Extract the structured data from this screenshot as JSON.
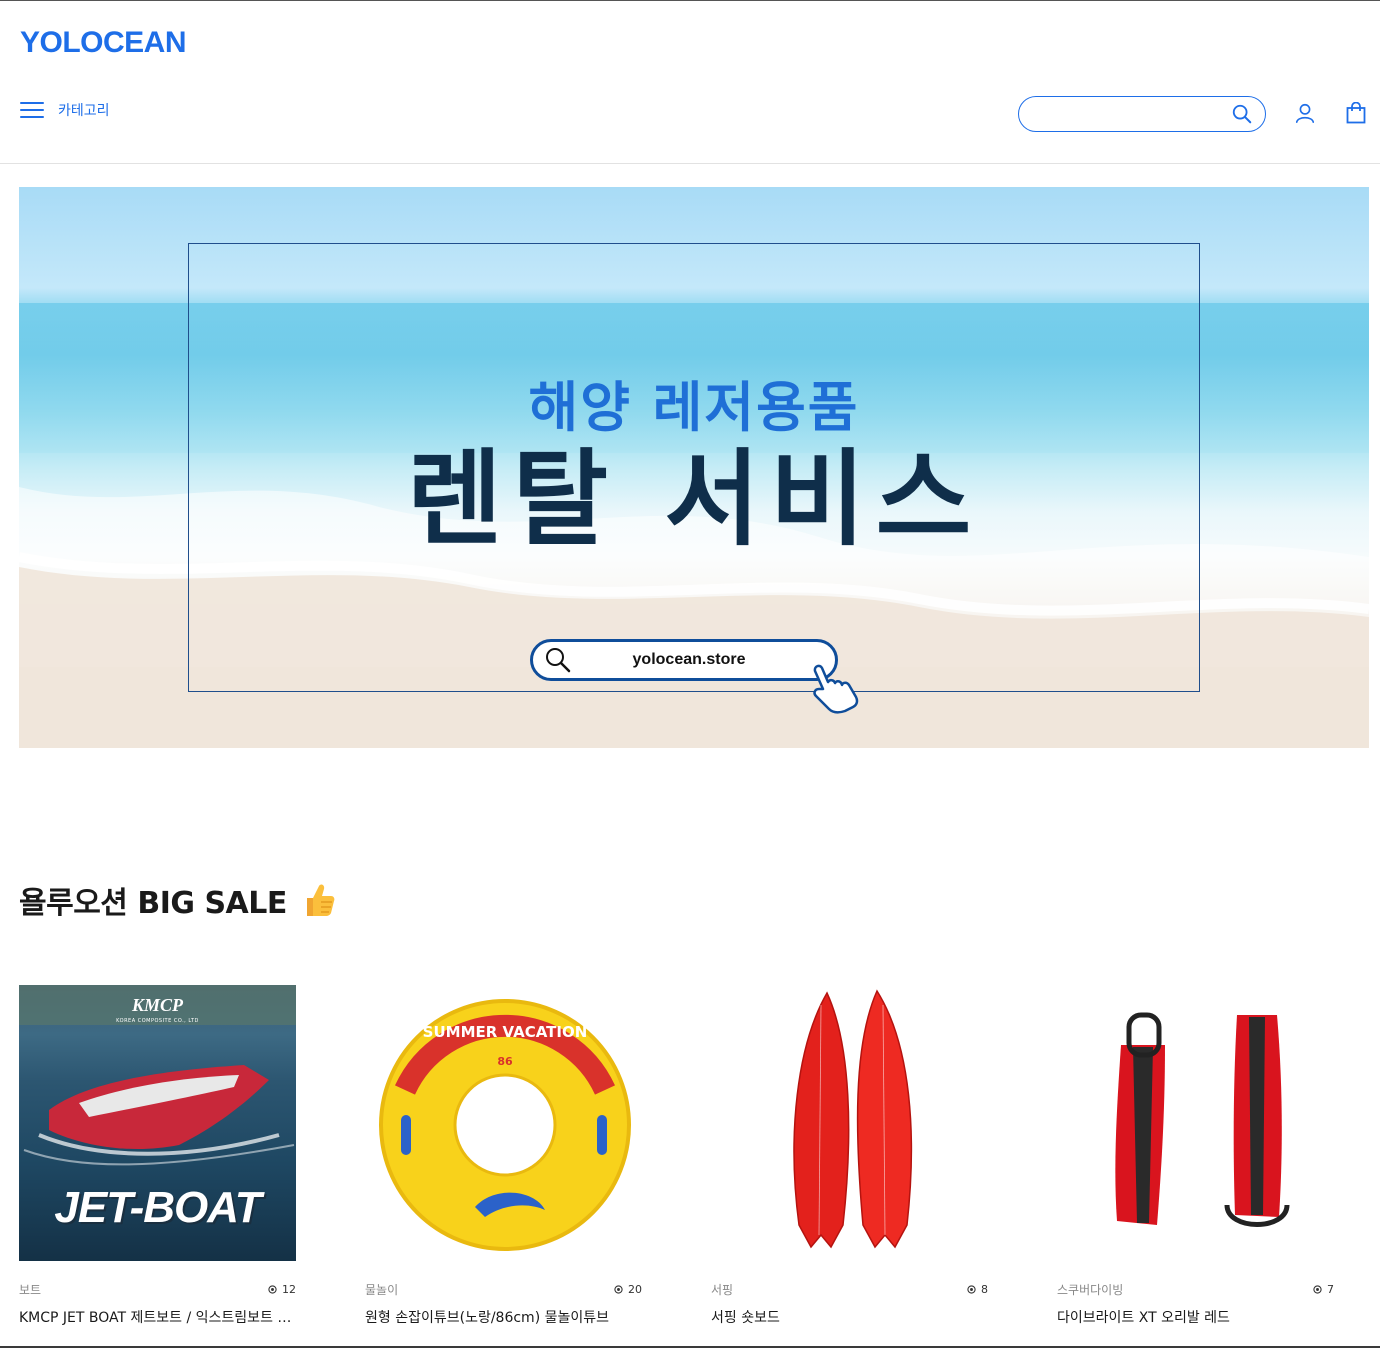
{
  "header": {
    "logo": "YOLOCEAN",
    "category_label": "카테고리",
    "search_placeholder": "",
    "search_value": ""
  },
  "banner": {
    "subtitle": "해양 레저용품",
    "title": "렌탈 서비스",
    "url": "yolocean.store"
  },
  "section": {
    "title": "욜루오션 BIG SALE"
  },
  "products": [
    {
      "category": "보트",
      "views": "12",
      "name": "KMCP JET BOAT 제트보트 / 익스트림보트 / 레저보트",
      "image_text": "JET-BOAT",
      "image_brand": "KMCP",
      "image_company": "KOREA COMPOSITE CO., LTD"
    },
    {
      "category": "물놀이",
      "views": "20",
      "name": "원형 손잡이튜브(노랑/86cm) 물놀이튜브",
      "image_text": "SUMMER VACATION",
      "image_size": "86"
    },
    {
      "category": "서핑",
      "views": "8",
      "name": "서핑 숏보드"
    },
    {
      "category": "스쿠버다이빙",
      "views": "7",
      "name": "다이브라이트 XT 오리발 레드"
    }
  ],
  "colors": {
    "brand": "#1e6ee8",
    "banner_title": "#0f2e4a",
    "banner_subtitle": "#1f6fd6"
  },
  "icons": [
    "hamburger-icon",
    "search-icon",
    "user-icon",
    "shopping-bag-icon",
    "thumbs-up-icon",
    "eye-icon",
    "pointing-hand-icon"
  ]
}
